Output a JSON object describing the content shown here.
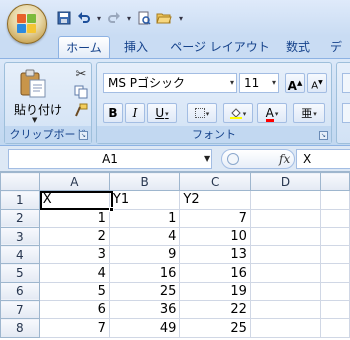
{
  "app": {
    "office_button_icon": "office-logo-icon",
    "quick_access": [
      {
        "name": "save-icon",
        "glyph": "💾"
      },
      {
        "name": "undo-icon",
        "glyph": "↶"
      },
      {
        "name": "redo-icon",
        "glyph": "↷"
      },
      {
        "name": "print-preview-icon",
        "glyph": "🔍"
      },
      {
        "name": "open-icon",
        "glyph": "📂"
      }
    ]
  },
  "tabs": [
    "ホーム",
    "挿入",
    "ページ レイアウト",
    "数式",
    "デ"
  ],
  "ribbon": {
    "clipboard": {
      "paste_label": "貼り付け",
      "group_label": "クリップボード"
    },
    "font": {
      "font_name": "MS Pゴシック",
      "font_size": "11",
      "grow_label": "A",
      "shrink_label": "A",
      "bold": "B",
      "italic": "I",
      "underline": "U",
      "font_color_label": "A",
      "phonetic_label": "亜",
      "group_label": "フォント"
    }
  },
  "formula_bar": {
    "name_box": "A1",
    "fx_label": "fx",
    "formula": "X"
  },
  "colors": {
    "highlight": "#ffff00",
    "font_color": "#ff0000",
    "accent": "#15428b"
  },
  "sheet": {
    "columns": [
      "A",
      "B",
      "C",
      "D"
    ],
    "row_numbers": [
      "1",
      "2",
      "3",
      "4",
      "5",
      "6",
      "7",
      "8"
    ],
    "header": [
      "X",
      "Y1",
      "Y2",
      ""
    ],
    "rows": [
      [
        "1",
        "1",
        "7",
        ""
      ],
      [
        "2",
        "4",
        "10",
        ""
      ],
      [
        "3",
        "9",
        "13",
        ""
      ],
      [
        "4",
        "16",
        "16",
        ""
      ],
      [
        "5",
        "25",
        "19",
        ""
      ],
      [
        "6",
        "36",
        "22",
        ""
      ],
      [
        "7",
        "49",
        "25",
        ""
      ]
    ],
    "selected_cell": "A1"
  }
}
